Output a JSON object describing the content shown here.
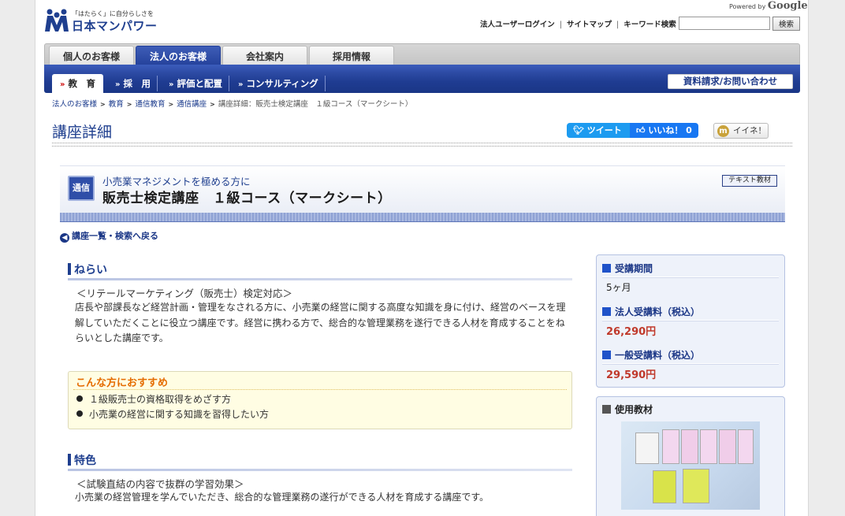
{
  "header": {
    "logo_tagline": "「はたらく」に自分らしさを",
    "logo_name": "日本マンパワー",
    "powered_by": "Powered by",
    "powered_brand": "Google",
    "links": [
      "法人ユーザーログイン",
      "サイトマップ",
      "キーワード検索"
    ],
    "search_placeholder": "",
    "search_button": "検索"
  },
  "global_nav": {
    "tabs": [
      {
        "label": "個人のお客様",
        "active": false
      },
      {
        "label": "法人のお客様",
        "active": true
      },
      {
        "label": "会社案内",
        "active": false
      },
      {
        "label": "採用情報",
        "active": false
      }
    ]
  },
  "sub_nav": {
    "items": [
      {
        "label": "教　育",
        "active": true
      },
      {
        "label": "採　用",
        "active": false
      },
      {
        "label": "評価と配置",
        "active": false
      },
      {
        "label": "コンサルティング",
        "active": false
      }
    ],
    "contact_label": "資料請求/お問い合わせ"
  },
  "breadcrumb": [
    "法人のお客様",
    "教育",
    "通信教育",
    "通信講座",
    "講座詳細：販売士検定講座　１級コース（マークシート）"
  ],
  "page_title": "講座詳細",
  "social": {
    "tweet": "ツイート",
    "like": "いいね！ 0",
    "iine_icon": "m",
    "iine": "イイネ！"
  },
  "course": {
    "badge": "通信",
    "catch": "小売業マネジメントを極める方に",
    "name": "販売士検定講座　１級コース（マークシート）",
    "tag": "テキスト教材",
    "back_link": "講座一覧・検索へ戻る"
  },
  "sections": {
    "aim": {
      "heading": "ねらい",
      "subhead": "＜リテールマーケティング（販売士）検定対応＞",
      "body": "店長や部課長など経営計画・管理をなされる方に、小売業の経営に関する高度な知識を身に付け、経営のベースを理解していただくことに役立つ講座です。経営に携わる方で、総合的な管理業務を遂行できる人材を育成することをねらいとした講座です。"
    },
    "recommend": {
      "heading": "こんな方におすすめ",
      "items": [
        "１級販売士の資格取得をめざす方",
        "小売業の経営に関する知識を習得したい方"
      ]
    },
    "feature": {
      "heading": "特色",
      "subhead": "＜試験直結の内容で抜群の学習効果＞",
      "body": "小売業の経営管理を学んでいただき、総合的な管理業務の遂行ができる人材を育成する講座です。"
    }
  },
  "info": {
    "period_label": "受講期間",
    "period_value": "5ヶ月",
    "corp_fee_label": "法人受講料（税込）",
    "corp_fee_value": "26,290円",
    "general_fee_label": "一般受講料（税込）",
    "general_fee_value": "29,590円",
    "material_label": "使用教材"
  },
  "colors": {
    "nav_blue": "#23409a",
    "title_blue": "#1f3f8f",
    "price_red": "#c0392b",
    "recommend_orange": "#e56c00",
    "tweet_blue": "#1d9bf0",
    "like_blue": "#1877f2"
  }
}
